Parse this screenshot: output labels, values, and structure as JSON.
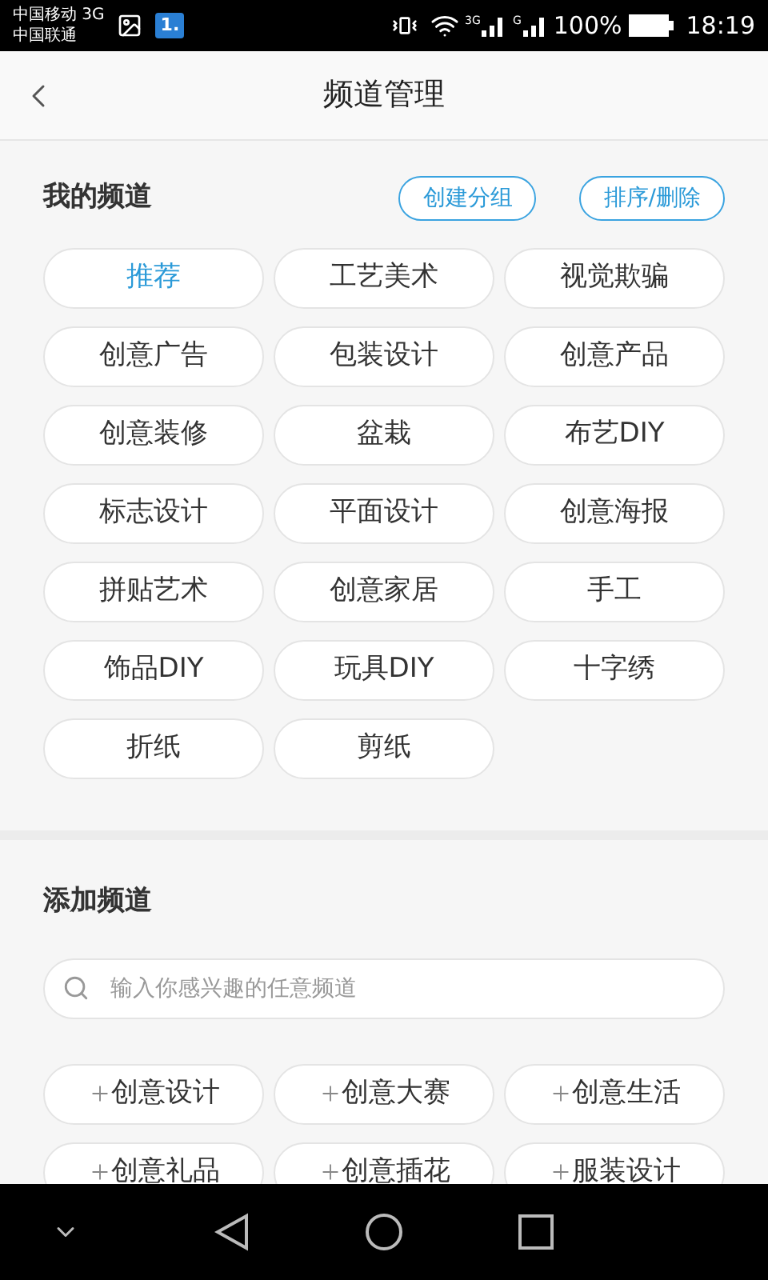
{
  "status_bar": {
    "carriers": [
      "中国移动 3G",
      "中国联通"
    ],
    "notification_badge": "1.",
    "signals": [
      "3G",
      "G"
    ],
    "battery": "100%",
    "time": "18:19"
  },
  "header": {
    "title": "频道管理"
  },
  "my_channels": {
    "title": "我的频道",
    "actions": [
      "创建分组",
      "排序/删除"
    ],
    "items": [
      {
        "label": "推荐",
        "selected": true
      },
      {
        "label": "工艺美术",
        "selected": false
      },
      {
        "label": "视觉欺骗",
        "selected": false
      },
      {
        "label": "创意广告",
        "selected": false
      },
      {
        "label": "包装设计",
        "selected": false
      },
      {
        "label": "创意产品",
        "selected": false
      },
      {
        "label": "创意装修",
        "selected": false
      },
      {
        "label": "盆栽",
        "selected": false
      },
      {
        "label": "布艺DIY",
        "selected": false
      },
      {
        "label": "标志设计",
        "selected": false
      },
      {
        "label": "平面设计",
        "selected": false
      },
      {
        "label": "创意海报",
        "selected": false
      },
      {
        "label": "拼贴艺术",
        "selected": false
      },
      {
        "label": "创意家居",
        "selected": false
      },
      {
        "label": "手工",
        "selected": false
      },
      {
        "label": "饰品DIY",
        "selected": false
      },
      {
        "label": "玩具DIY",
        "selected": false
      },
      {
        "label": "十字绣",
        "selected": false
      },
      {
        "label": "折纸",
        "selected": false
      },
      {
        "label": "剪纸",
        "selected": false
      }
    ]
  },
  "add_channels": {
    "title": "添加频道",
    "search": {
      "placeholder": "输入你感兴趣的任意频道"
    },
    "items": [
      "创意设计",
      "创意大赛",
      "创意生活",
      "创意礼品",
      "创意插花",
      "服装设计"
    ]
  }
}
